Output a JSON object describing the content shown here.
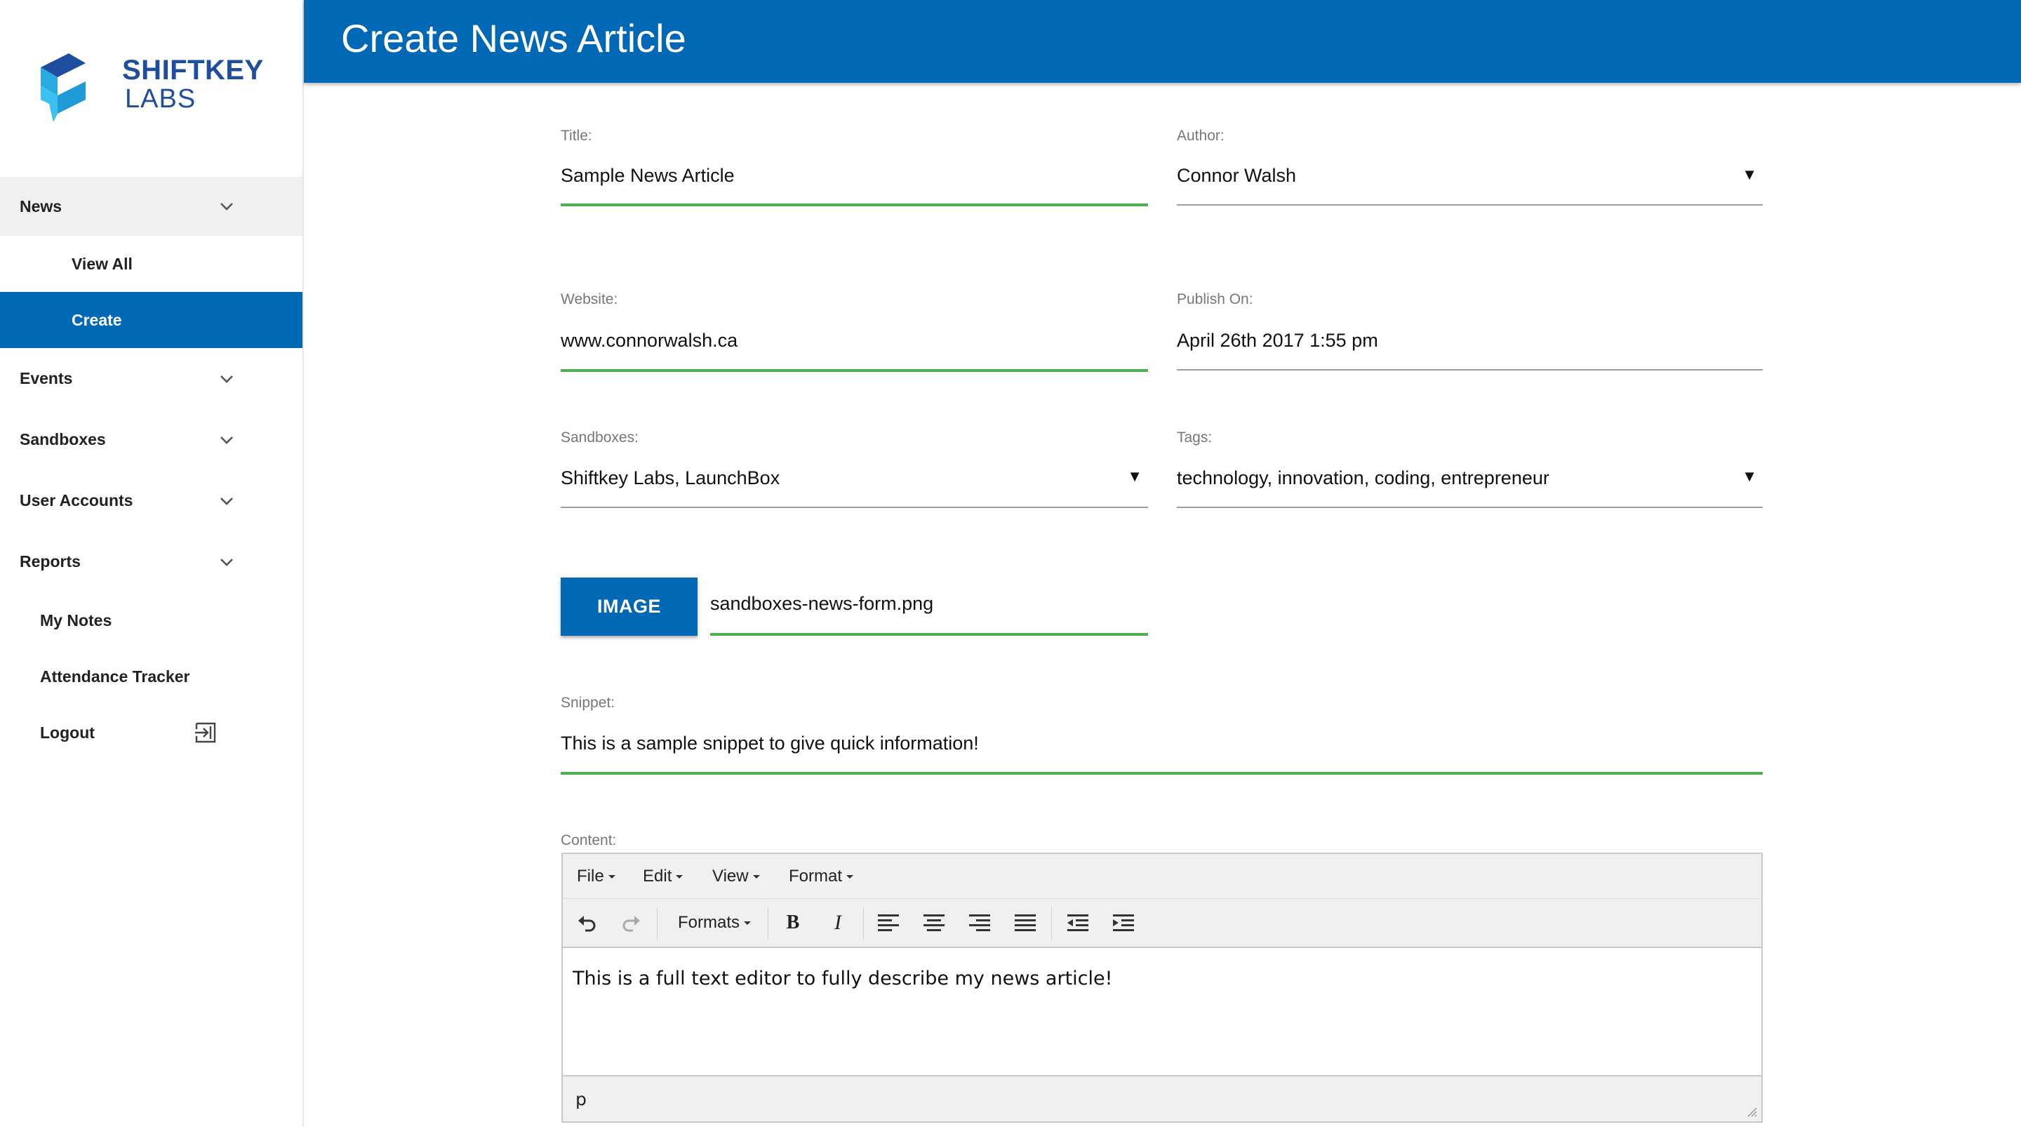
{
  "brand": {
    "line1": "SHIFTKEY",
    "line2": "LABS",
    "colors": {
      "dark": "#1f4e9e",
      "light": "#29abe2"
    }
  },
  "header": {
    "title": "Create News Article",
    "color": "#0068b5"
  },
  "sidebar": {
    "news": {
      "label": "News",
      "icon": "chevron-down-icon"
    },
    "news_children": [
      {
        "label": "View All"
      },
      {
        "label": "Create",
        "active": true
      }
    ],
    "events": {
      "label": "Events",
      "icon": "chevron-down-icon"
    },
    "sandboxes": {
      "label": "Sandboxes",
      "icon": "chevron-down-icon"
    },
    "user_accounts": {
      "label": "User Accounts",
      "icon": "chevron-down-icon"
    },
    "reports": {
      "label": "Reports",
      "icon": "chevron-down-icon"
    },
    "my_notes": {
      "label": "My Notes"
    },
    "attendance": {
      "label": "Attendance Tracker"
    },
    "logout": {
      "label": "Logout",
      "icon": "logout-icon"
    }
  },
  "form": {
    "title": {
      "label": "Title:",
      "value": "Sample News Article"
    },
    "author": {
      "label": "Author:",
      "value": "Connor Walsh"
    },
    "website": {
      "label": "Website:",
      "value": "www.connorwalsh.ca"
    },
    "publish_on": {
      "label": "Publish On:",
      "value": "April 26th 2017 1:55 pm"
    },
    "sandboxes": {
      "label": "Sandboxes:",
      "value": "Shiftkey Labs, LaunchBox"
    },
    "tags": {
      "label": "Tags:",
      "value": "technology, innovation, coding, entrepreneur"
    },
    "image": {
      "button_label": "IMAGE",
      "filename": "sandboxes-news-form.png"
    },
    "snippet": {
      "label": "Snippet:",
      "value": "This is a sample snippet to give quick information!"
    },
    "content": {
      "label": "Content:"
    },
    "dropdown_caret": "▼"
  },
  "editor": {
    "menus": [
      "File",
      "Edit",
      "View",
      "Format"
    ],
    "formats_label": "Formats",
    "bold_label": "B",
    "italic_label": "I",
    "body_text": "This is a full text editor to fully describe my news article!",
    "status_path": "p"
  },
  "accent_colors": {
    "primary": "#0068b5",
    "valid_underline": "#4caf50"
  }
}
